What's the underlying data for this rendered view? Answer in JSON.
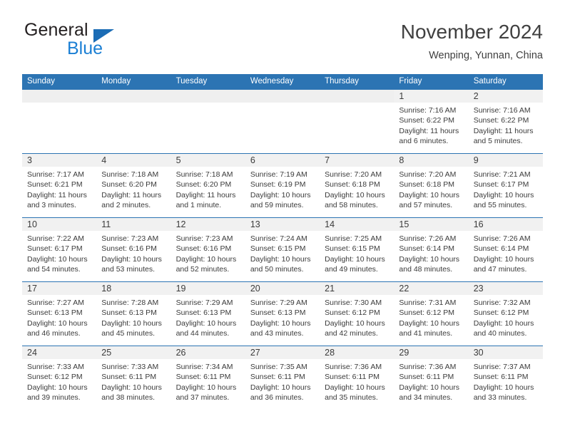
{
  "brand": {
    "word_one": "General",
    "word_two": "Blue",
    "triangle_icon": "brand-triangle-icon",
    "colors": {
      "general_text": "#231f20",
      "blue_text": "#1b7fd4",
      "triangle": "#1b6cb5"
    }
  },
  "header": {
    "title": "November 2024",
    "subtitle": "Wenping, Yunnan, China"
  },
  "theme": {
    "header_blue": "#2c74b3",
    "daynum_band": "#f1f1f1",
    "empty_band": "#efefef",
    "text": "#3b3b3b"
  },
  "calendar": {
    "weekday_headers": [
      "Sunday",
      "Monday",
      "Tuesday",
      "Wednesday",
      "Thursday",
      "Friday",
      "Saturday"
    ],
    "weeks": [
      [
        {
          "day": "",
          "lines": []
        },
        {
          "day": "",
          "lines": []
        },
        {
          "day": "",
          "lines": []
        },
        {
          "day": "",
          "lines": []
        },
        {
          "day": "",
          "lines": []
        },
        {
          "day": "1",
          "lines": [
            "Sunrise: 7:16 AM",
            "Sunset: 6:22 PM",
            "Daylight: 11 hours",
            "and 6 minutes."
          ]
        },
        {
          "day": "2",
          "lines": [
            "Sunrise: 7:16 AM",
            "Sunset: 6:22 PM",
            "Daylight: 11 hours",
            "and 5 minutes."
          ]
        }
      ],
      [
        {
          "day": "3",
          "lines": [
            "Sunrise: 7:17 AM",
            "Sunset: 6:21 PM",
            "Daylight: 11 hours",
            "and 3 minutes."
          ]
        },
        {
          "day": "4",
          "lines": [
            "Sunrise: 7:18 AM",
            "Sunset: 6:20 PM",
            "Daylight: 11 hours",
            "and 2 minutes."
          ]
        },
        {
          "day": "5",
          "lines": [
            "Sunrise: 7:18 AM",
            "Sunset: 6:20 PM",
            "Daylight: 11 hours",
            "and 1 minute."
          ]
        },
        {
          "day": "6",
          "lines": [
            "Sunrise: 7:19 AM",
            "Sunset: 6:19 PM",
            "Daylight: 10 hours",
            "and 59 minutes."
          ]
        },
        {
          "day": "7",
          "lines": [
            "Sunrise: 7:20 AM",
            "Sunset: 6:18 PM",
            "Daylight: 10 hours",
            "and 58 minutes."
          ]
        },
        {
          "day": "8",
          "lines": [
            "Sunrise: 7:20 AM",
            "Sunset: 6:18 PM",
            "Daylight: 10 hours",
            "and 57 minutes."
          ]
        },
        {
          "day": "9",
          "lines": [
            "Sunrise: 7:21 AM",
            "Sunset: 6:17 PM",
            "Daylight: 10 hours",
            "and 55 minutes."
          ]
        }
      ],
      [
        {
          "day": "10",
          "lines": [
            "Sunrise: 7:22 AM",
            "Sunset: 6:17 PM",
            "Daylight: 10 hours",
            "and 54 minutes."
          ]
        },
        {
          "day": "11",
          "lines": [
            "Sunrise: 7:23 AM",
            "Sunset: 6:16 PM",
            "Daylight: 10 hours",
            "and 53 minutes."
          ]
        },
        {
          "day": "12",
          "lines": [
            "Sunrise: 7:23 AM",
            "Sunset: 6:16 PM",
            "Daylight: 10 hours",
            "and 52 minutes."
          ]
        },
        {
          "day": "13",
          "lines": [
            "Sunrise: 7:24 AM",
            "Sunset: 6:15 PM",
            "Daylight: 10 hours",
            "and 50 minutes."
          ]
        },
        {
          "day": "14",
          "lines": [
            "Sunrise: 7:25 AM",
            "Sunset: 6:15 PM",
            "Daylight: 10 hours",
            "and 49 minutes."
          ]
        },
        {
          "day": "15",
          "lines": [
            "Sunrise: 7:26 AM",
            "Sunset: 6:14 PM",
            "Daylight: 10 hours",
            "and 48 minutes."
          ]
        },
        {
          "day": "16",
          "lines": [
            "Sunrise: 7:26 AM",
            "Sunset: 6:14 PM",
            "Daylight: 10 hours",
            "and 47 minutes."
          ]
        }
      ],
      [
        {
          "day": "17",
          "lines": [
            "Sunrise: 7:27 AM",
            "Sunset: 6:13 PM",
            "Daylight: 10 hours",
            "and 46 minutes."
          ]
        },
        {
          "day": "18",
          "lines": [
            "Sunrise: 7:28 AM",
            "Sunset: 6:13 PM",
            "Daylight: 10 hours",
            "and 45 minutes."
          ]
        },
        {
          "day": "19",
          "lines": [
            "Sunrise: 7:29 AM",
            "Sunset: 6:13 PM",
            "Daylight: 10 hours",
            "and 44 minutes."
          ]
        },
        {
          "day": "20",
          "lines": [
            "Sunrise: 7:29 AM",
            "Sunset: 6:13 PM",
            "Daylight: 10 hours",
            "and 43 minutes."
          ]
        },
        {
          "day": "21",
          "lines": [
            "Sunrise: 7:30 AM",
            "Sunset: 6:12 PM",
            "Daylight: 10 hours",
            "and 42 minutes."
          ]
        },
        {
          "day": "22",
          "lines": [
            "Sunrise: 7:31 AM",
            "Sunset: 6:12 PM",
            "Daylight: 10 hours",
            "and 41 minutes."
          ]
        },
        {
          "day": "23",
          "lines": [
            "Sunrise: 7:32 AM",
            "Sunset: 6:12 PM",
            "Daylight: 10 hours",
            "and 40 minutes."
          ]
        }
      ],
      [
        {
          "day": "24",
          "lines": [
            "Sunrise: 7:33 AM",
            "Sunset: 6:12 PM",
            "Daylight: 10 hours",
            "and 39 minutes."
          ]
        },
        {
          "day": "25",
          "lines": [
            "Sunrise: 7:33 AM",
            "Sunset: 6:11 PM",
            "Daylight: 10 hours",
            "and 38 minutes."
          ]
        },
        {
          "day": "26",
          "lines": [
            "Sunrise: 7:34 AM",
            "Sunset: 6:11 PM",
            "Daylight: 10 hours",
            "and 37 minutes."
          ]
        },
        {
          "day": "27",
          "lines": [
            "Sunrise: 7:35 AM",
            "Sunset: 6:11 PM",
            "Daylight: 10 hours",
            "and 36 minutes."
          ]
        },
        {
          "day": "28",
          "lines": [
            "Sunrise: 7:36 AM",
            "Sunset: 6:11 PM",
            "Daylight: 10 hours",
            "and 35 minutes."
          ]
        },
        {
          "day": "29",
          "lines": [
            "Sunrise: 7:36 AM",
            "Sunset: 6:11 PM",
            "Daylight: 10 hours",
            "and 34 minutes."
          ]
        },
        {
          "day": "30",
          "lines": [
            "Sunrise: 7:37 AM",
            "Sunset: 6:11 PM",
            "Daylight: 10 hours",
            "and 33 minutes."
          ]
        }
      ]
    ]
  }
}
